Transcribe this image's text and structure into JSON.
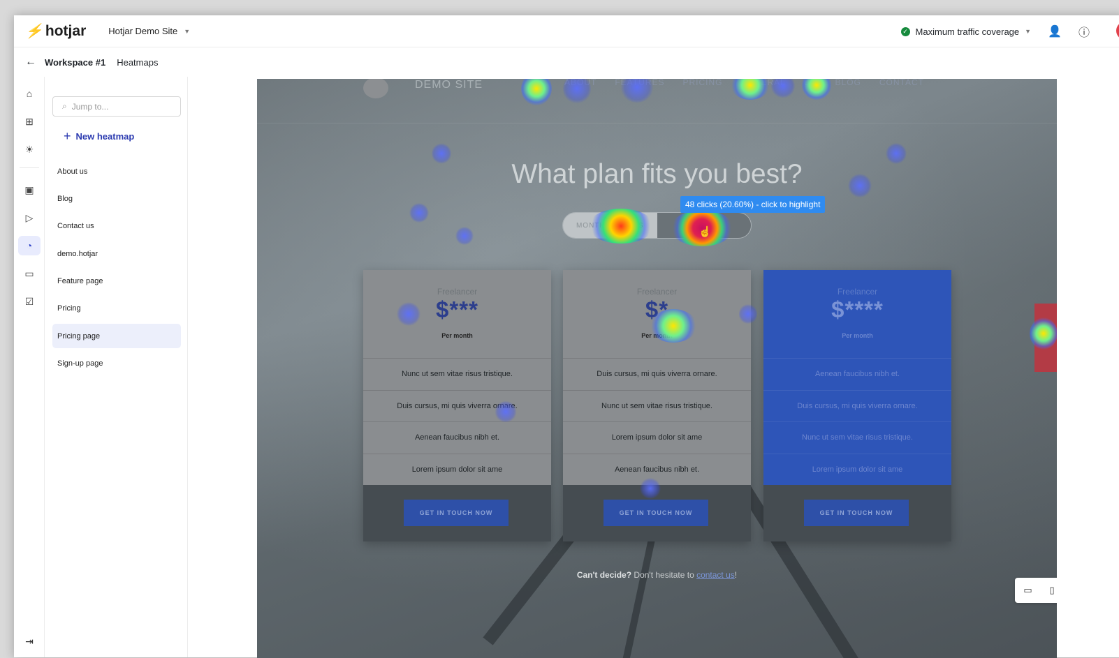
{
  "app": {
    "logo": "hotjar",
    "site": "Hotjar Demo Site"
  },
  "topbar": {
    "coverage": "Maximum traffic coverage"
  },
  "breadcrumb": {
    "workspace": "Workspace #1",
    "section": "Heatmaps"
  },
  "sidebar": {
    "search_placeholder": "Jump to...",
    "new_heatmap": "New heatmap",
    "pages": [
      {
        "label": "About us"
      },
      {
        "label": "Blog"
      },
      {
        "label": "Contact us"
      },
      {
        "label": "demo.hotjar"
      },
      {
        "label": "Feature page"
      },
      {
        "label": "Pricing"
      },
      {
        "label": "Pricing page",
        "selected": true
      },
      {
        "label": "Sign-up page"
      }
    ]
  },
  "heatmap": {
    "site_name": "DEMO SITE",
    "nav_links": [
      "ABOUT",
      "FEATURES",
      "PRICING",
      "UNDERAL",
      "UP",
      "BLOG",
      "CONTACT"
    ],
    "headline": "What plan fits you best?",
    "toggle": {
      "left": "MONTHLY PLANS",
      "right": ""
    },
    "tooltip": "48 clicks (20.60%) - click to highlight",
    "cards": [
      {
        "tier": "Freelancer",
        "price": "$***",
        "per": "Per month",
        "features": [
          "Nunc ut sem vitae risus tristique.",
          "Duis cursus, mi quis viverra ornare.",
          "Aenean faucibus nibh et.",
          "Lorem ipsum dolor sit ame"
        ],
        "cta": "GET IN TOUCH NOW"
      },
      {
        "tier": "Freelancer",
        "price": "$*",
        "per": "Per month",
        "features": [
          "Duis cursus, mi quis viverra ornare.",
          "Nunc ut sem vitae risus tristique.",
          "Lorem ipsum dolor sit ame",
          "Aenean faucibus nibh et."
        ],
        "cta": "GET IN TOUCH NOW"
      },
      {
        "tier": "Freelancer",
        "price": "$****",
        "per": "Per month",
        "features": [
          "Aenean faucibus nibh et.",
          "Duis cursus, mi quis viverra ornare.",
          "Nunc ut sem vitae risus tristique.",
          "Lorem ipsum dolor sit ame"
        ],
        "cta": "GET IN TOUCH NOW"
      }
    ],
    "footer": {
      "bold": "Can't decide?",
      "text": " Don't hesitate to ",
      "link": "contact us",
      "end": "!"
    }
  },
  "icons": {
    "rail": [
      "home-icon",
      "dashboards-icon",
      "bulb-icon",
      "trends-icon",
      "recordings-icon",
      "heatmaps-icon",
      "feedback-icon",
      "surveys-icon"
    ],
    "collapse": "expand-icon"
  },
  "colors": {
    "brand": "#ff3c00",
    "accent": "#2c3bb0",
    "tooltip": "#2f8bf0",
    "ok": "#168a3d"
  }
}
